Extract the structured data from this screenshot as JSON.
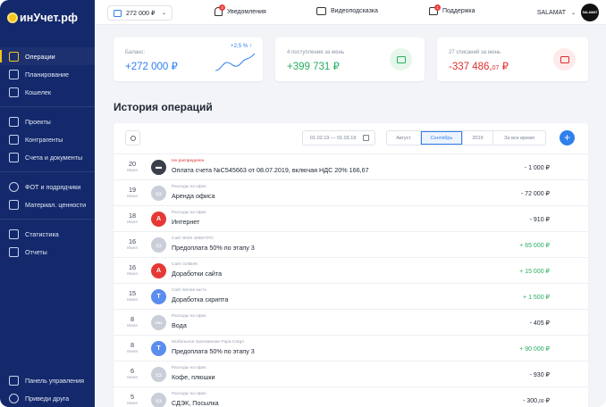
{
  "brand": {
    "logo_text": "инУчет.рф"
  },
  "topbar": {
    "balance_select": "272 000 ₽",
    "notifications_label": "Уведомления",
    "notifications_count": "3",
    "video_label": "Видеоподсказка",
    "support_label": "Поддержка",
    "support_count": "1",
    "user_name": "SALAMAT",
    "avatar_text": "SALAMAT"
  },
  "sidebar": {
    "items": [
      {
        "label": "Операции",
        "active": true
      },
      {
        "label": "Планирование"
      },
      {
        "label": "Кошелек"
      },
      {
        "label": "Проекты"
      },
      {
        "label": "Контрагенты"
      },
      {
        "label": "Счета и документы"
      },
      {
        "label": "ФОТ и подрядчики"
      },
      {
        "label": "Материал. ценности"
      },
      {
        "label": "Статистика"
      },
      {
        "label": "Отчеты"
      }
    ],
    "bottom": [
      {
        "label": "Панель управления"
      },
      {
        "label": "Приведи друга"
      }
    ]
  },
  "cards": {
    "balance": {
      "caption": "Баланс:",
      "value": "+272 000 ₽",
      "trend": "+2,5 % ↑",
      "color": "#2f80ed"
    },
    "income": {
      "caption": "4 поступления за июнь",
      "value": "+399 731 ₽",
      "color": "#27ae60"
    },
    "expense": {
      "caption": "27 списаний за июнь",
      "value_main": "-337 486,",
      "value_cents": "07",
      "value_cur": " ₽",
      "color": "#e02e2e"
    }
  },
  "history": {
    "title": "История операций",
    "date_range": "01.02.19 — 01.03.19",
    "tabs": [
      "Август",
      "Сентябрь",
      "2019",
      "За все время"
    ],
    "active_tab": "Сентябрь",
    "add_label": "+",
    "rows": [
      {
        "day": "20",
        "month": "Июня",
        "avatar": "▬",
        "av_color": "#3a3f4b",
        "category": "Не распределен",
        "category_alert": true,
        "title": "Оплата счета №С545663 от 08.07.2019, включая НДС 20% 166,67",
        "amount": "- 1 000 ₽",
        "positive": false
      },
      {
        "day": "19",
        "month": "Июня",
        "avatar": "▭",
        "av_color": "#c9ced8",
        "category": "Расходы на офис",
        "title": "Аренда офиса",
        "amount": "- 72 000 ₽",
        "positive": false
      },
      {
        "day": "18",
        "month": "Июня",
        "avatar": "A",
        "av_color": "#e53935",
        "category": "Расходы на офис",
        "title": "Интернет",
        "amount": "- 910 ₽",
        "positive": false
      },
      {
        "day": "16",
        "month": "Июня",
        "avatar": "▭",
        "av_color": "#c9ced8",
        "category": "Сайт ВОМ ЭЛЕКТРО",
        "title": "Предоплата 50% по этапу 3",
        "amount": "+ 65 000 ₽",
        "positive": true
      },
      {
        "day": "16",
        "month": "Июня",
        "avatar": "A",
        "av_color": "#e53935",
        "category": "Сайт GetBett",
        "title": "Доработки сайта",
        "amount": "+ 15 000 ₽",
        "positive": true
      },
      {
        "day": "15",
        "month": "Июня",
        "avatar": "T",
        "av_color": "#5b8def",
        "category": "Сайт Белая кисть",
        "title": "Доработка скрипта",
        "amount": "+ 1 500 ₽",
        "positive": true
      },
      {
        "day": "8",
        "month": "Июня",
        "avatar": "VISA",
        "av_color": "#c9ced8",
        "category": "Расходы на офис",
        "title": "Вода",
        "amount": "- 405 ₽",
        "positive": false
      },
      {
        "day": "8",
        "month": "Июня",
        "avatar": "T",
        "av_color": "#5b8def",
        "category": "Мобильное приложение Papa Cargo",
        "title": "Предоплата 50% по этапу 3",
        "amount": "+ 90 000 ₽",
        "positive": true
      },
      {
        "day": "6",
        "month": "Июня",
        "avatar": "▭",
        "av_color": "#c9ced8",
        "category": "Расходы на офис",
        "title": "Кофе, плюшки",
        "amount": "- 930 ₽",
        "positive": false
      },
      {
        "day": "5",
        "month": "Июня",
        "avatar": "▭",
        "av_color": "#c9ced8",
        "category": "Расходы на офис",
        "title": "СДЭК, Посылка",
        "amount_main": "- 300,",
        "amount_cents": "00",
        "amount_cur": " ₽",
        "positive": false
      }
    ]
  }
}
